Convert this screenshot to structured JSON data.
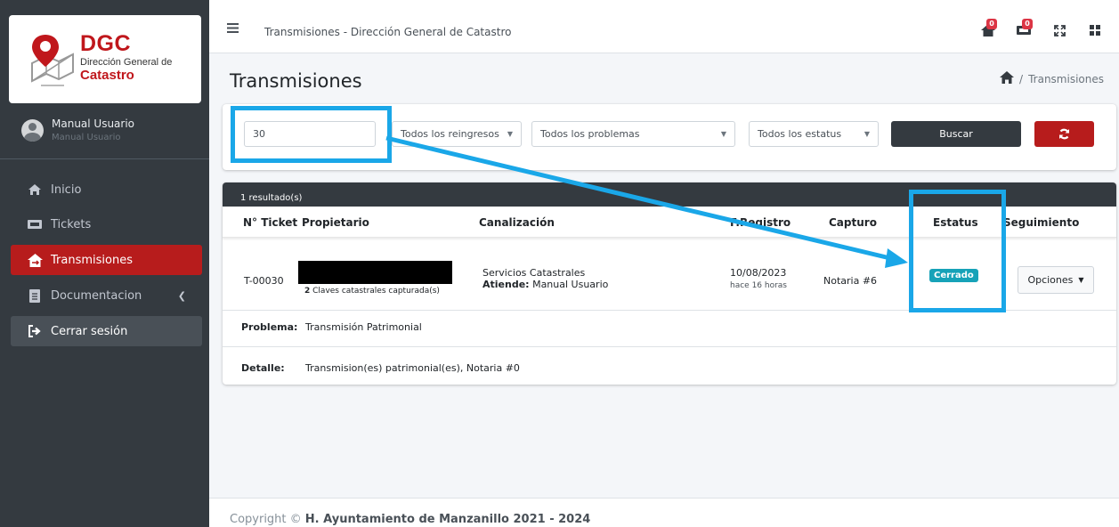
{
  "brand": {
    "abbr": "DGC",
    "line1": "Dirección General de",
    "line2": "Catastro"
  },
  "user": {
    "name": "Manual Usuario",
    "subtitle": "Manual Usuario"
  },
  "sidebar": {
    "items": [
      {
        "label": "Inicio",
        "icon": "home-icon"
      },
      {
        "label": "Tickets",
        "icon": "ticket-icon"
      },
      {
        "label": "Transmisiones",
        "icon": "house-transfer-icon"
      },
      {
        "label": "Documentacion",
        "icon": "document-icon"
      },
      {
        "label": "Cerrar sesión",
        "icon": "logout-icon"
      }
    ]
  },
  "topbar": {
    "title": "Transmisiones - Dirección General de Catastro",
    "badge1": "0",
    "badge2": "0"
  },
  "page": {
    "title": "Transmisiones",
    "breadcrumb": "Transmisiones"
  },
  "filters": {
    "search_value": "30",
    "reingresos": "Todos los reingresos",
    "problemas": "Todos los problemas",
    "estatus": "Todos los estatus",
    "search_button": "Buscar"
  },
  "results": {
    "count": "1 resultado(s)",
    "columns": [
      "N° Ticket",
      "Propietario",
      "Canalización",
      "F.Registro",
      "Capturo",
      "Estatus",
      "Seguimiento"
    ],
    "row": {
      "ticket": "T-00030",
      "claves_count": "2",
      "claves_text": "Claves catastrales capturada(s)",
      "canalizacion": "Servicios Catastrales",
      "atiende_label": "Atiende:",
      "atiende_value": "Manual Usuario",
      "fecha": "10/08/2023",
      "hace": "hace 16 horas",
      "capturo": "Notaria #6",
      "estatus": "Cerrado",
      "opciones": "Opciones"
    },
    "problema_label": "Problema:",
    "problema_value": "Transmisión Patrimonial",
    "detalle_label": "Detalle:",
    "detalle_value": "Transmision(es) patrimonial(es), Notaria #0"
  },
  "footer": {
    "prefix": "Copyright ©",
    "org": "H. Ayuntamiento de Manzanillo 2021 - 2024"
  },
  "colors": {
    "sidebar": "#343a40",
    "accent_red": "#b71c1c",
    "status_info": "#17a2b8",
    "annotation": "#1aa7e8"
  }
}
